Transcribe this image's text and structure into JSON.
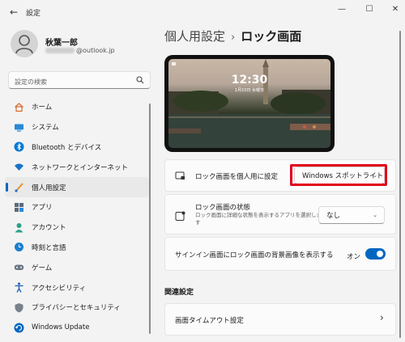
{
  "window": {
    "title": "設定",
    "back_icon": "←",
    "minimize_icon": "—",
    "maximize_icon": "☐",
    "close_icon": "✕"
  },
  "user": {
    "name": "秋葉一郎",
    "email_suffix": "@outlook.jp"
  },
  "search": {
    "placeholder": "設定の検索"
  },
  "sidebar": {
    "items": [
      {
        "label": "ホーム",
        "icon": "home-icon",
        "active": false
      },
      {
        "label": "システム",
        "icon": "system-icon",
        "active": false
      },
      {
        "label": "Bluetooth とデバイス",
        "icon": "bluetooth-icon",
        "active": false
      },
      {
        "label": "ネットワークとインターネット",
        "icon": "wifi-icon",
        "active": false
      },
      {
        "label": "個人用設定",
        "icon": "brush-icon",
        "active": true
      },
      {
        "label": "アプリ",
        "icon": "apps-icon",
        "active": false
      },
      {
        "label": "アカウント",
        "icon": "account-icon",
        "active": false
      },
      {
        "label": "時刻と言語",
        "icon": "clock-icon",
        "active": false
      },
      {
        "label": "ゲーム",
        "icon": "gamepad-icon",
        "active": false
      },
      {
        "label": "アクセシビリティ",
        "icon": "accessibility-icon",
        "active": false
      },
      {
        "label": "プライバシーとセキュリティ",
        "icon": "shield-icon",
        "active": false
      },
      {
        "label": "Windows Update",
        "icon": "update-icon",
        "active": false
      }
    ]
  },
  "breadcrumb": {
    "parent": "個人用設定",
    "separator": "›",
    "current": "ロック画面"
  },
  "preview": {
    "time": "12:30",
    "date": "1月10日 水曜日"
  },
  "settings": {
    "personalize": {
      "title": "ロック画面を個人用に設定",
      "value": "Windows スポットライト",
      "chevron": "⌄"
    },
    "status": {
      "title": "ロック画面の状態",
      "description": "ロック画面に詳細な状態を表示するアプリを選択します",
      "value": "なし",
      "chevron": "⌄"
    },
    "signin_bg": {
      "title": "サインイン画面にロック画面の背景画像を表示する",
      "toggle_label": "オン",
      "toggle_on": true
    }
  },
  "related": {
    "title": "関連設定",
    "items": [
      {
        "label": "画面タイムアウト設定",
        "chevron": "›"
      }
    ]
  },
  "colors": {
    "accent": "#0067c0",
    "highlight_box": "#e2001a"
  }
}
